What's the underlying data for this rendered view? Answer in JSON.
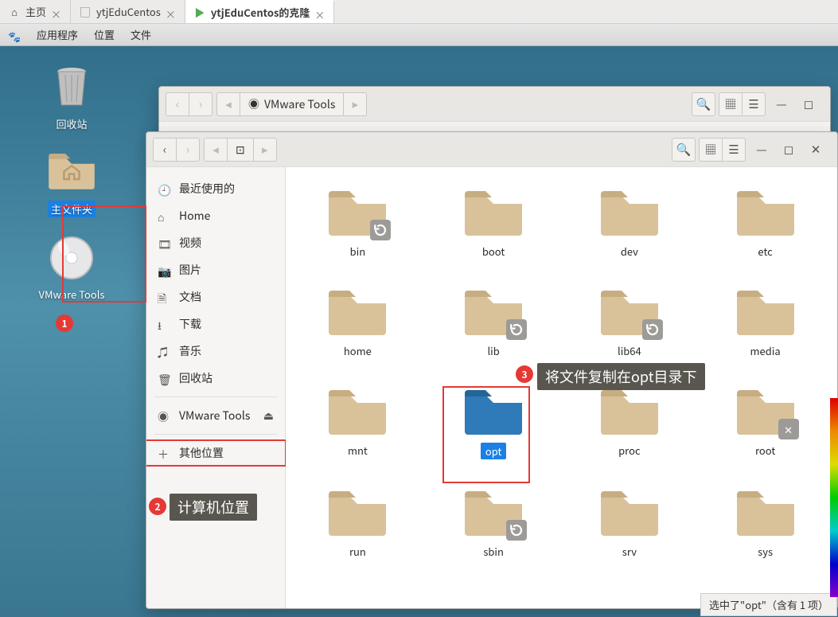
{
  "tabs": [
    {
      "label": "主页",
      "active": false,
      "icon": "home"
    },
    {
      "label": "ytjEduCentos",
      "active": false,
      "icon": "vm"
    },
    {
      "label": "ytjEduCentos的克隆",
      "active": true,
      "icon": "vm-on"
    }
  ],
  "gnomemenu": {
    "apps": "应用程序",
    "places": "位置",
    "files": "文件"
  },
  "desktop": {
    "trash": "回收站",
    "home": "主文件夹",
    "vmtools": "VMware Tools"
  },
  "bgwin_path": "VMware Tools",
  "sidebar": {
    "recent": "最近使用的",
    "home": "Home",
    "videos": "视频",
    "pictures": "图片",
    "documents": "文档",
    "downloads": "下载",
    "music": "音乐",
    "trash": "回收站",
    "vmtools": "VMware Tools",
    "other": "其他位置"
  },
  "folders": [
    {
      "name": "bin",
      "link": true
    },
    {
      "name": "boot"
    },
    {
      "name": "dev"
    },
    {
      "name": "etc"
    },
    {
      "name": "home"
    },
    {
      "name": "lib",
      "link": true
    },
    {
      "name": "lib64",
      "link": true
    },
    {
      "name": "media"
    },
    {
      "name": "mnt"
    },
    {
      "name": "opt",
      "selected": true
    },
    {
      "name": "proc"
    },
    {
      "name": "root",
      "locked": true
    },
    {
      "name": "run"
    },
    {
      "name": "sbin",
      "link": true
    },
    {
      "name": "srv"
    },
    {
      "name": "sys"
    }
  ],
  "statusbar": "选中了\"opt\"（含有 1 项）",
  "annotations": {
    "a1": "1",
    "a2": "2",
    "a2_tip": "计算机位置",
    "a3": "3",
    "a3_tip": "将文件复制在opt目录下"
  }
}
